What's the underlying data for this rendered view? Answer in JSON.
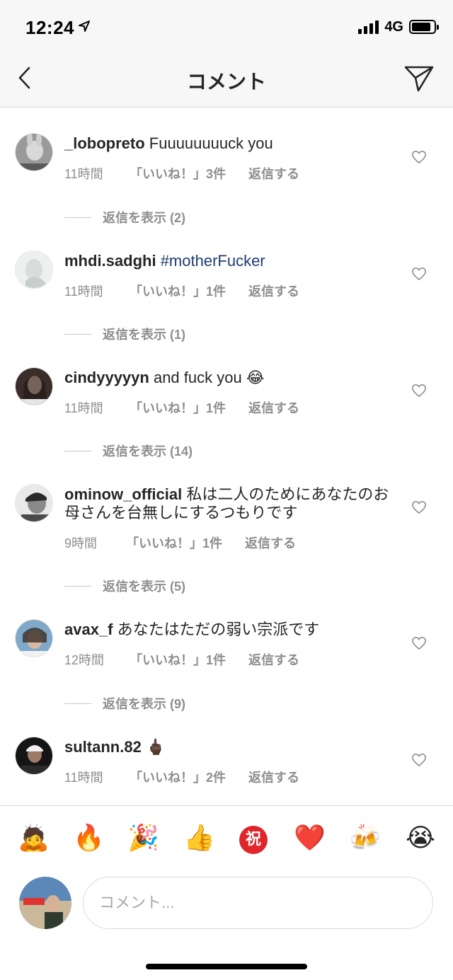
{
  "status_bar": {
    "time": "12:24",
    "network": "4G"
  },
  "nav": {
    "title": "コメント"
  },
  "comments": [
    {
      "username": "_lobopreto",
      "text": " Fuuuuuuuuck you",
      "hashtag": "",
      "emoji": "",
      "time": "11時間",
      "likes": "「いいね！」3件",
      "reply": "返信する",
      "view_replies": "返信を表示 (2)"
    },
    {
      "username": "mhdi.sadghi",
      "text": " ",
      "hashtag": "#motherFucker",
      "emoji": "",
      "time": "11時間",
      "likes": "「いいね！」1件",
      "reply": "返信する",
      "view_replies": "返信を表示 (1)"
    },
    {
      "username": "cindyyyyyn",
      "text": " and fuck you ",
      "hashtag": "",
      "emoji": "😂",
      "time": "11時間",
      "likes": "「いいね！」1件",
      "reply": "返信する",
      "view_replies": "返信を表示 (14)"
    },
    {
      "username": "ominow_official",
      "text": " 私は二人のためにあなたのお母さんを台無しにするつもりです",
      "hashtag": "",
      "emoji": "",
      "time": "9時間",
      "likes": "「いいね！」1件",
      "reply": "返信する",
      "view_replies": "返信を表示 (5)"
    },
    {
      "username": "avax_f",
      "text": " あなたはただの弱い宗派です",
      "hashtag": "",
      "emoji": "",
      "time": "12時間",
      "likes": "「いいね！」1件",
      "reply": "返信する",
      "view_replies": "返信を表示 (9)"
    },
    {
      "username": "sultann.82",
      "text": " ",
      "hashtag": "",
      "emoji": "🖕🏿",
      "time": "11時間",
      "likes": "「いいね！」2件",
      "reply": "返信する",
      "view_replies": ""
    }
  ],
  "emoji_bar": [
    "🙇",
    "🔥",
    "🎉",
    "👍",
    "祝",
    "❤️",
    "🍻",
    "😭"
  ],
  "composer": {
    "placeholder": "コメント..."
  },
  "colors": {
    "hashtag": "#1f3c6e",
    "muted": "#8e8e8e",
    "text": "#262626",
    "iwai_red": "#e0262a"
  },
  "icons": [
    "location-arrow-icon",
    "signal-icon",
    "battery-icon",
    "back-chevron-icon",
    "direct-send-icon",
    "heart-icon"
  ]
}
